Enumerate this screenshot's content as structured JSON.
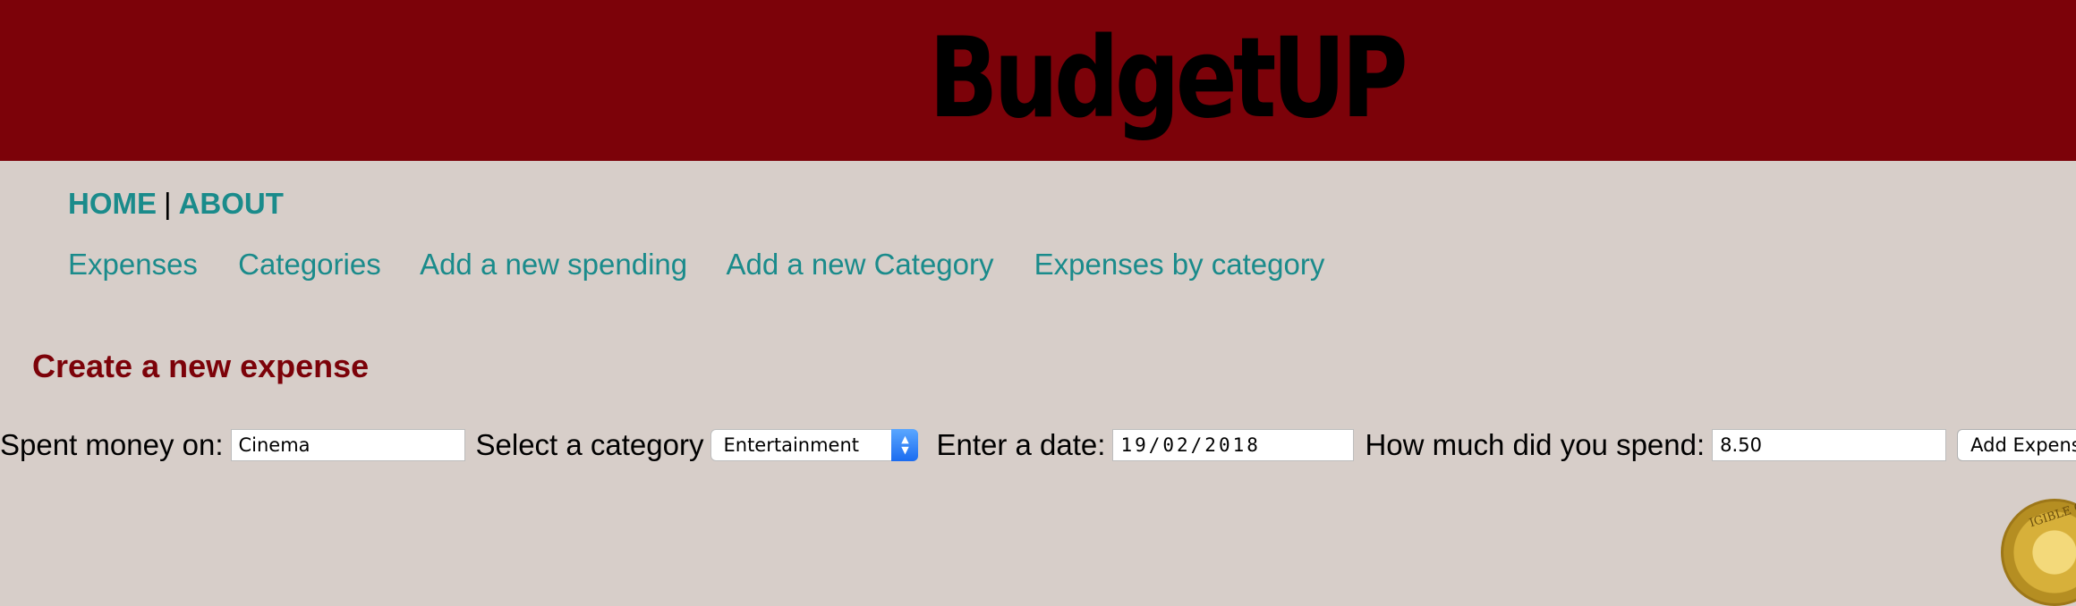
{
  "header": {
    "brand": "BudgetUP",
    "background_color": "#7c0209"
  },
  "top_nav": {
    "home": "HOME",
    "separator": "|",
    "about": "ABOUT"
  },
  "sub_nav": {
    "items": [
      "Expenses",
      "Categories",
      "Add a new spending",
      "Add a new Category",
      "Expenses by category"
    ],
    "link_color": "#1a8b8b"
  },
  "form": {
    "title": "Create a new expense",
    "spent_label": "Spent money on:",
    "spent_value": "Cinema",
    "category_label": "Select a category",
    "category_value": "Entertainment",
    "date_label": "Enter a date:",
    "date_value": "19/02/2018",
    "amount_label": "How much did you spend:",
    "amount_value": "8.50",
    "submit_label": "Add Expense"
  },
  "seal": {
    "text": "IGIBLE C"
  },
  "colors": {
    "page_background": "#d7cec9",
    "title_color": "#7c0209"
  }
}
